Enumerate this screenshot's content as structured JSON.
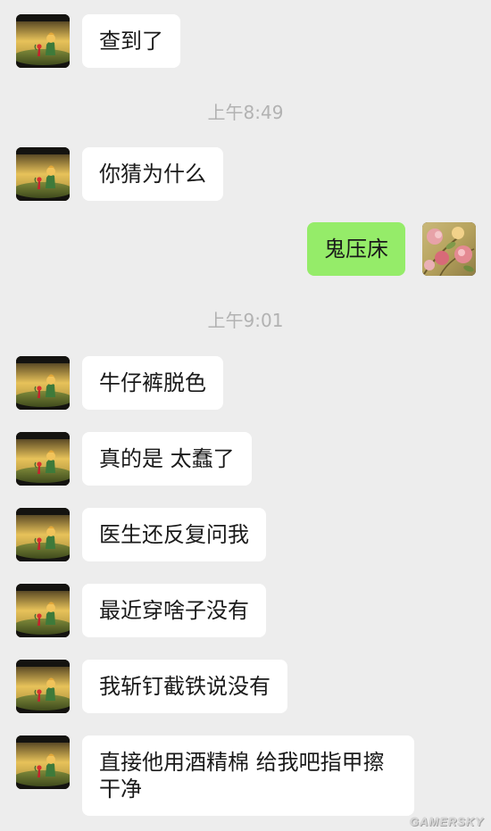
{
  "chat": {
    "timestamps": [
      "上午8:49",
      "上午9:01"
    ],
    "messages": [
      {
        "sender": "contact",
        "text": "查到了"
      },
      {
        "sender": "contact",
        "text": "你猜为什么"
      },
      {
        "sender": "me",
        "text": "鬼压床"
      },
      {
        "sender": "contact",
        "text": "牛仔裤脱色"
      },
      {
        "sender": "contact",
        "text": "真的是 太蠢了"
      },
      {
        "sender": "contact",
        "text": "医生还反复问我"
      },
      {
        "sender": "contact",
        "text": "最近穿啥子没有"
      },
      {
        "sender": "contact",
        "text": "我斩钉截铁说没有"
      },
      {
        "sender": "contact",
        "text": "直接他用酒精棉 给我吧指甲擦干净"
      }
    ]
  },
  "avatars": {
    "contact_icon": "little-prince-avatar-icon",
    "me_icon": "flower-avatar-icon"
  },
  "colors": {
    "background": "#ededed",
    "contact_bubble": "#ffffff",
    "my_bubble": "#95ec69",
    "timestamp_text": "#b2b2b2"
  },
  "watermark": "GAMERSKY"
}
